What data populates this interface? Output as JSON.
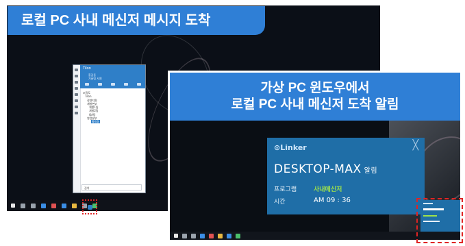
{
  "badge": {
    "title": "로컬 PC 사내 메신저 메시지 도착"
  },
  "local_messenger": {
    "window_title": "Tilon",
    "user_lines": [
      "홍길동",
      "기술팀 사원"
    ],
    "tree": [
      "조직도",
      "Tilon",
      "경영지원",
      "개발본부",
      "개발1팀",
      "개발2팀",
      "QA팀",
      "영업본부",
      "홍길동"
    ],
    "search_placeholder": "검색"
  },
  "virtual_panel": {
    "header_line1": "가상 PC 윈도우에서",
    "header_line2": "로컬 PC 사내 메신저 도착 알림"
  },
  "notification": {
    "brand": "Linker",
    "close_glyph": "╳",
    "host": "DESKTOP-MAX",
    "host_tag": "알림",
    "program_label": "프로그램",
    "program_value": "사내메신저",
    "time_label": "시간",
    "time_value": "AM 09 : 36"
  },
  "colors": {
    "accent": "#2f7fd6",
    "notif_bg": "#1f6ea7",
    "highlight": "#e02424",
    "program_value": "#9fe34a"
  }
}
